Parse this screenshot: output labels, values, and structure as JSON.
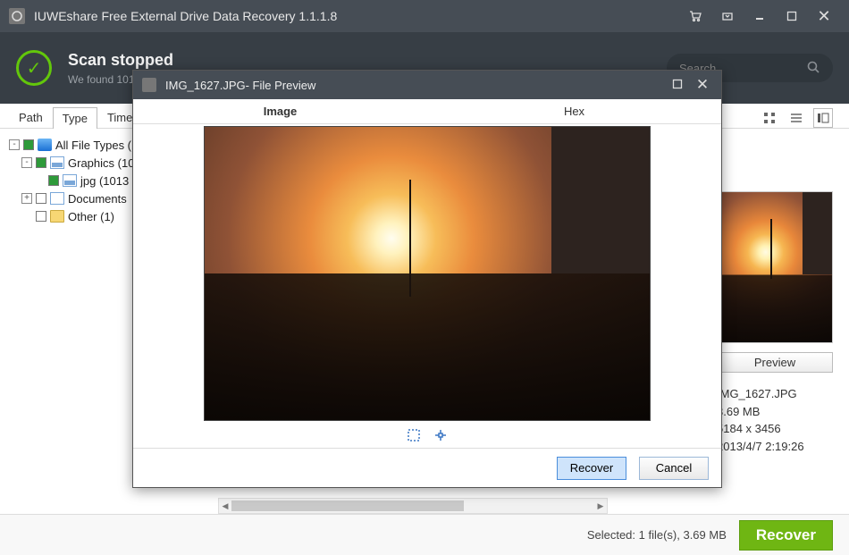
{
  "app": {
    "title": "IUWEshare Free External Drive Data Recovery 1.1.1.8"
  },
  "status": {
    "title": "Scan stopped",
    "subtitle": "We found 101"
  },
  "search": {
    "placeholder": "Search"
  },
  "main_tabs": {
    "path": "Path",
    "type": "Type",
    "time": "Time"
  },
  "tree": {
    "root": "All File Types (10",
    "graphics": "Graphics (10",
    "jpg": "jpg (1013",
    "documents": "Documents",
    "other": "Other (1)"
  },
  "detail": {
    "preview_button": "Preview",
    "filename": "IMG_1627.JPG",
    "size_line": "3.69 MB",
    "dimensions": "5184 x 3456",
    "timestamp": "2013/4/7 2:19:26"
  },
  "footer": {
    "selection": "Selected: 1 file(s), 3.69 MB",
    "recover": "Recover"
  },
  "modal": {
    "title": "IMG_1627.JPG- File Preview",
    "tab_image": "Image",
    "tab_hex": "Hex",
    "recover": "Recover",
    "cancel": "Cancel"
  }
}
